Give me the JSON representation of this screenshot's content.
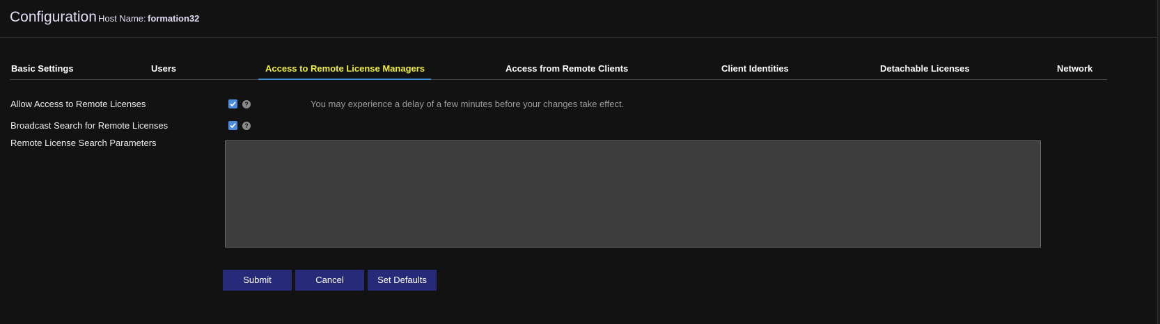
{
  "header": {
    "title": "Configuration",
    "host_label": "Host Name:",
    "host_value": "formation32"
  },
  "tabs": [
    {
      "label": "Basic Settings",
      "active": false
    },
    {
      "label": "Users",
      "active": false
    },
    {
      "label": "Access to Remote License Managers",
      "active": true
    },
    {
      "label": "Access from Remote Clients",
      "active": false
    },
    {
      "label": "Client Identities",
      "active": false
    },
    {
      "label": "Detachable Licenses",
      "active": false
    },
    {
      "label": "Network",
      "active": false
    }
  ],
  "form": {
    "allow_access": {
      "label": "Allow Access to Remote Licenses",
      "checked": true,
      "help_icon": "question-circle-icon"
    },
    "broadcast_search": {
      "label": "Broadcast Search for Remote Licenses",
      "checked": true,
      "help_icon": "question-circle-icon"
    },
    "search_params": {
      "label": "Remote License Search Parameters",
      "value": ""
    },
    "notice": "You may experience a delay of a few minutes before your changes take effect."
  },
  "buttons": {
    "submit": "Submit",
    "cancel": "Cancel",
    "set_defaults": "Set Defaults"
  },
  "colors": {
    "background": "#121212",
    "active_tab": "#f0ee3c",
    "tab_underline": "#3b8fd6",
    "button": "#262a78",
    "checkbox": "#4b8bdb"
  }
}
